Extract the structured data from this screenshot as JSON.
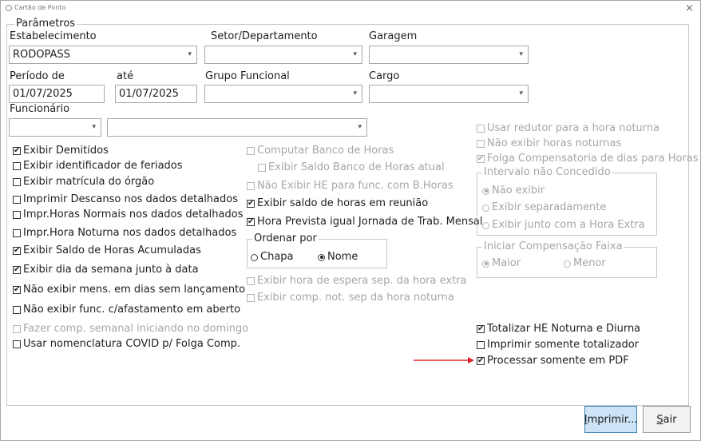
{
  "window": {
    "title": "Cartão de Ponto",
    "close_glyph": "×"
  },
  "group_parametros": {
    "legend": "Parâmetros",
    "estabelecimento": {
      "label": "Estabelecimento",
      "value": "RODOPASS"
    },
    "setor": {
      "label": "Setor/Departamento",
      "value": ""
    },
    "garagem": {
      "label": "Garagem",
      "value": ""
    },
    "periodo_de": {
      "label": "Período de",
      "value": "01/07/2025"
    },
    "periodo_ate": {
      "label": "até",
      "value": "01/07/2025"
    },
    "grupo_funcional": {
      "label": "Grupo Funcional",
      "value": ""
    },
    "cargo": {
      "label": "Cargo",
      "value": ""
    },
    "funcionario": {
      "label": "Funcionário",
      "value": ""
    }
  },
  "left_options": [
    {
      "label": "Exibir Demitidos",
      "checked": true,
      "enabled": true
    },
    {
      "label": "Exibir identificador de feriados",
      "checked": false,
      "enabled": true
    },
    {
      "label": "Exibir matrícula do órgão",
      "checked": false,
      "enabled": true
    },
    {
      "label": "Imprimir Descanso nos dados detalhados",
      "checked": false,
      "enabled": true
    },
    {
      "label": "Impr.Horas Normais nos dados detalhados",
      "checked": false,
      "enabled": true
    },
    {
      "label": "Impr.Hora Noturna nos dados detalhados",
      "checked": false,
      "enabled": true
    },
    {
      "label": "Exibir Saldo de Horas Acumuladas",
      "checked": true,
      "enabled": true
    },
    {
      "label": "Exibir dia da semana junto à data",
      "checked": true,
      "enabled": true
    },
    {
      "label": "Não exibir mens. em dias sem lançamento",
      "checked": true,
      "enabled": true
    },
    {
      "label": "Não exibir func. c/afastamento em aberto",
      "checked": false,
      "enabled": true
    },
    {
      "label": "Fazer comp. semanal iniciando no domingo",
      "checked": false,
      "enabled": false
    },
    {
      "label": "Usar nomenclatura COVID p/ Folga Comp.",
      "checked": false,
      "enabled": true
    }
  ],
  "middle_options": [
    {
      "label": "Computar Banco de Horas",
      "checked": false,
      "enabled": false
    },
    {
      "label": "Exibir Saldo Banco de Horas atual",
      "checked": false,
      "enabled": false
    },
    {
      "label": "Não Exibir HE para func. com B.Horas",
      "checked": false,
      "enabled": false
    },
    {
      "label": "Exibir saldo de horas em reunião",
      "checked": true,
      "enabled": true
    },
    {
      "label": "Hora Prevista igual Jornada de Trab. Mensal",
      "checked": true,
      "enabled": true
    },
    {
      "label": "Exibir hora de espera sep. da hora extra",
      "checked": false,
      "enabled": false
    },
    {
      "label": "Exibir comp. not. sep da hora noturna",
      "checked": false,
      "enabled": false
    }
  ],
  "ordenar_por": {
    "legend": "Ordenar por",
    "options": [
      {
        "label": "Chapa",
        "selected": false
      },
      {
        "label": "Nome",
        "selected": true
      }
    ]
  },
  "right_options": [
    {
      "label": "Usar redutor para a hora noturna",
      "checked": false,
      "enabled": false
    },
    {
      "label": "Não exibir horas noturnas",
      "checked": false,
      "enabled": false
    },
    {
      "label": "Folga Compensatoria de dias para Horas",
      "checked": true,
      "enabled": false
    }
  ],
  "intervalo": {
    "legend": "Intervalo não Concedido",
    "options": [
      {
        "label": "Não exibir",
        "selected": true
      },
      {
        "label": "Exibir separadamente",
        "selected": false
      },
      {
        "label": "Exibir junto com a Hora Extra",
        "selected": false
      }
    ]
  },
  "compensacao": {
    "legend": "Iniciar Compensação Faixa",
    "options": [
      {
        "label": "Maior",
        "selected": true
      },
      {
        "label": "Menor",
        "selected": false
      }
    ]
  },
  "totals_options": [
    {
      "label": "Totalizar HE Noturna e Diurna",
      "checked": true,
      "enabled": true
    },
    {
      "label": "Imprimir somente totalizador",
      "checked": false,
      "enabled": true
    },
    {
      "label": "Processar somente em PDF",
      "checked": true,
      "enabled": true
    }
  ],
  "buttons": {
    "print": {
      "mnemonic": "I",
      "rest": "mprimir..."
    },
    "exit": {
      "mnemonic": "S",
      "rest": "air"
    }
  },
  "colors": {
    "annotation_arrow": "#e0262a",
    "primary_button_bg": "#cde4f7",
    "primary_button_border": "#3c7fb1"
  }
}
